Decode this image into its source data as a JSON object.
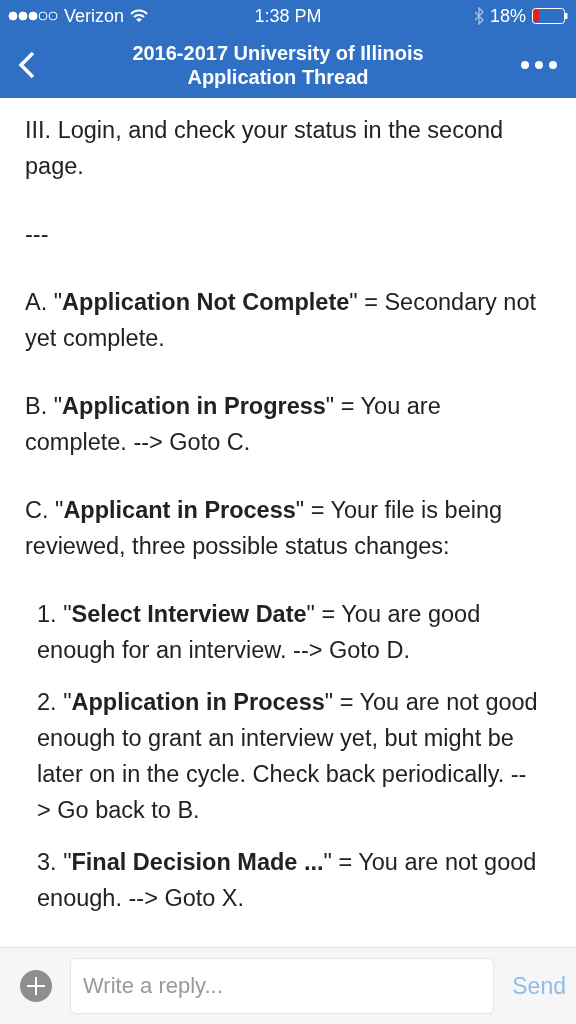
{
  "status_bar": {
    "carrier": "Verizon",
    "time": "1:38 PM",
    "battery": "18%"
  },
  "nav": {
    "title_lines": [
      "2016-2017 University of Illinois",
      "Application Thread"
    ]
  },
  "post": [
    {
      "kind": "paragraph",
      "text": "III. Login, and check your status in the second page."
    },
    {
      "kind": "paragraph",
      "text": "---"
    },
    {
      "kind": "paragraph",
      "text": "A. \"**Application Not Complete**\" = Secondary not yet complete."
    },
    {
      "kind": "paragraph",
      "text": "B. \"**Application in Progress**\" = You are complete. --> Goto C."
    },
    {
      "kind": "paragraph",
      "text": "C. \"**Applicant in Process**\" = Your file is being reviewed, three possible status changes:"
    },
    {
      "kind": "list_item",
      "text": "1. \"**Select Interview Date**\" = You are good enough for an interview. --> Goto D."
    },
    {
      "kind": "list_item",
      "text": "2. \"**Application in Process**\" = You are not good enough to grant an interview yet, but might be later on in the cycle. Check back periodically. --> Go back to B."
    },
    {
      "kind": "list_item",
      "text": "3. \"**Final Decision Made ...**\" = You are not good enough. --> Goto X."
    }
  ],
  "reply_bar": {
    "placeholder": "Write a reply...",
    "send": {
      "label": "Send",
      "disabled": true
    }
  }
}
